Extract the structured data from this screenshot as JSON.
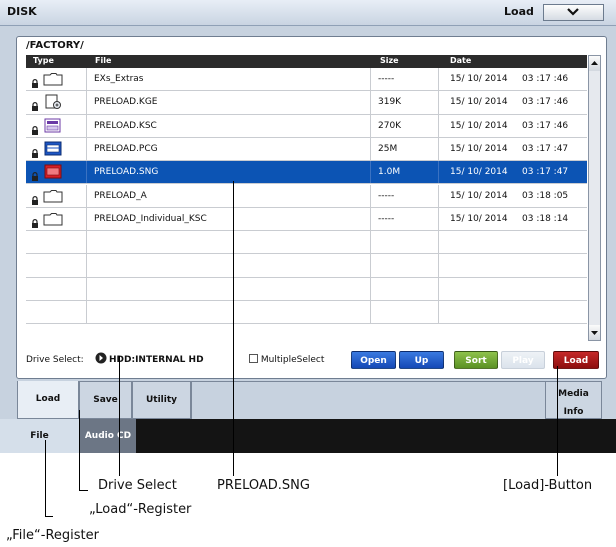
{
  "header": {
    "title": "DISK",
    "page_label": "Load"
  },
  "path": "/FACTORY/",
  "table": {
    "columns": [
      "Type",
      "File",
      "Size",
      "Date"
    ],
    "rows": [
      {
        "icon": "folder-icon",
        "name": "EXs_Extras",
        "size": "-----",
        "date": "15/ 10/ 2014",
        "time": "03 :17 :46"
      },
      {
        "icon": "kge-file-icon",
        "name": "PRELOAD.KGE",
        "size": "319K",
        "date": "15/ 10/ 2014",
        "time": "03 :17 :46"
      },
      {
        "icon": "ksc-file-icon",
        "name": "PRELOAD.KSC",
        "size": "270K",
        "date": "15/ 10/ 2014",
        "time": "03 :17 :46"
      },
      {
        "icon": "pcg-file-icon",
        "name": "PRELOAD.PCG",
        "size": "25M",
        "date": "15/ 10/ 2014",
        "time": "03 :17 :47"
      },
      {
        "icon": "sng-file-icon",
        "name": "PRELOAD.SNG",
        "size": "1.0M",
        "date": "15/ 10/ 2014",
        "time": "03 :17 :47"
      },
      {
        "icon": "folder-icon",
        "name": "PRELOAD_A",
        "size": "-----",
        "date": "15/ 10/ 2014",
        "time": "03 :18 :05"
      },
      {
        "icon": "folder-icon",
        "name": "PRELOAD_Individual_KSC",
        "size": "-----",
        "date": "15/ 10/ 2014",
        "time": "03 :18 :14"
      }
    ],
    "selected_index": 4
  },
  "drive_select": {
    "label": "Drive Select:",
    "value": "HDD:INTERNAL HD"
  },
  "multiple_select": {
    "label": "MultipleSelect",
    "checked": false
  },
  "buttons": {
    "open": "Open",
    "up": "Up",
    "sort": "Sort",
    "play": "Play",
    "load": "Load"
  },
  "tabs": {
    "load": "Load",
    "save": "Save",
    "utility": "Utility",
    "media_info": [
      "Media",
      "Info"
    ]
  },
  "subtabs": {
    "file": "File",
    "audio_cd": "Audio CD"
  },
  "callouts": {
    "drive_select": "Drive Select",
    "preload_sng": "PRELOAD.SNG",
    "load_button": "[Load]-Button",
    "load_tab": "„Load“-Register",
    "file_tab": "„File“-Register"
  },
  "colors": {
    "selected_row": "#0c54b4",
    "load_button": "#a51818",
    "sort_button": "#76a83a",
    "open_button": "#1f5cc8"
  }
}
